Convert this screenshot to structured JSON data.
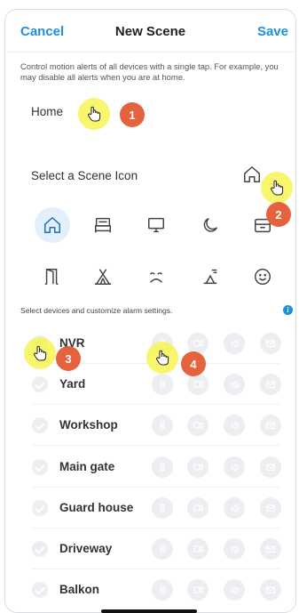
{
  "nav": {
    "cancel_label": "Cancel",
    "title": "New Scene",
    "save_label": "Save"
  },
  "description": "Control motion alerts of all devices with a single tap. For example, you may disable all alerts when you are at home.",
  "scene": {
    "name": "Home"
  },
  "icon_section": {
    "label": "Select a Scene Icon",
    "selected_icon": "home-icon"
  },
  "icons": [
    "home-icon",
    "bed-icon",
    "monitor-icon",
    "moon-icon",
    "garage-icon",
    "door-icon",
    "tent-icon",
    "sleeping-face-icon",
    "sunset-icon",
    "smiley-icon"
  ],
  "devices_hint": "Select devices and customize alarm settings.",
  "info_label": "i",
  "alarm_icons": [
    "motion-icon",
    "record-icon",
    "siren-icon",
    "email-icon"
  ],
  "devices": [
    {
      "name": "NVR"
    },
    {
      "name": "Yard"
    },
    {
      "name": "Workshop"
    },
    {
      "name": "Main gate"
    },
    {
      "name": "Guard house"
    },
    {
      "name": "Driveway"
    },
    {
      "name": "Balkon"
    }
  ],
  "steps": [
    "1",
    "2",
    "3",
    "4"
  ],
  "colors": {
    "accent": "#1d8fe0",
    "step_badge": "#e5623f",
    "highlight": "#f6f454"
  }
}
